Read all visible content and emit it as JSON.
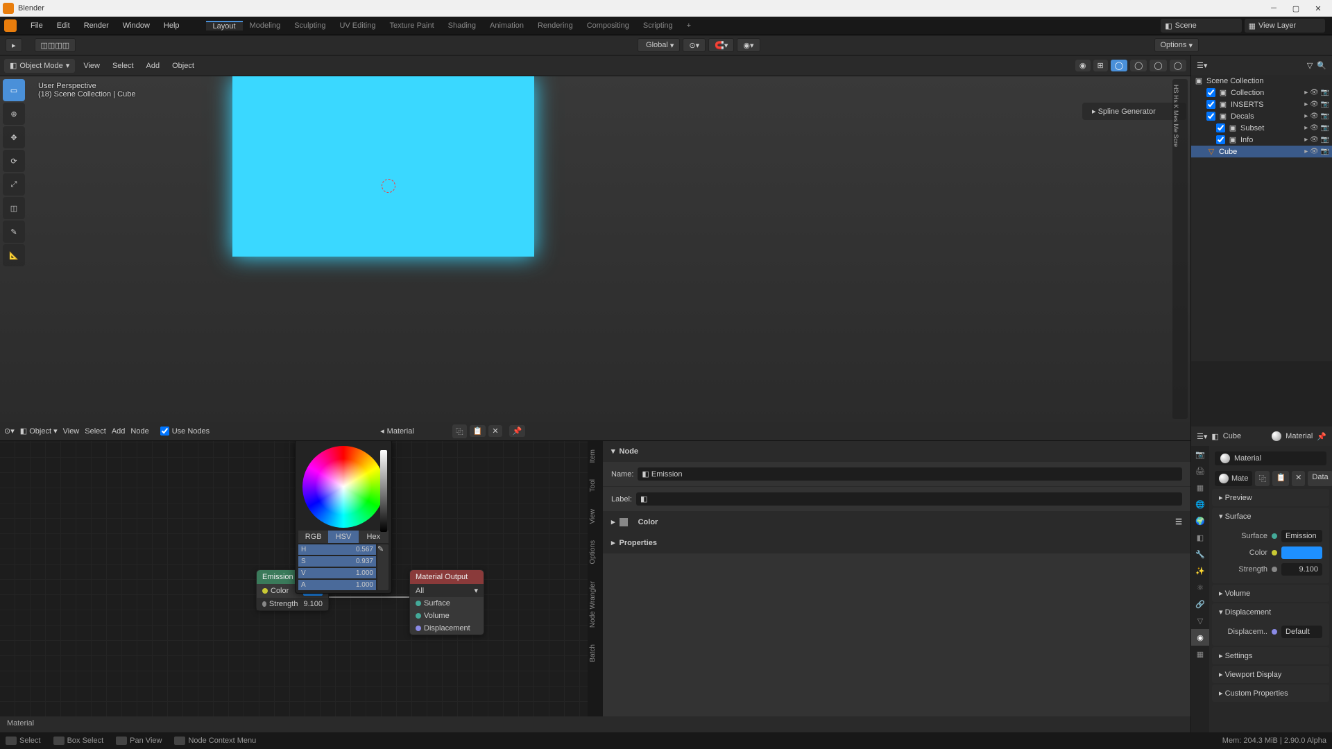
{
  "titlebar": {
    "app": "Blender"
  },
  "topmenu": {
    "file": "File",
    "edit": "Edit",
    "render": "Render",
    "window": "Window",
    "help": "Help"
  },
  "workspaces": [
    "Layout",
    "Modeling",
    "Sculpting",
    "UV Editing",
    "Texture Paint",
    "Shading",
    "Animation",
    "Rendering",
    "Compositing",
    "Scripting"
  ],
  "scene_field": {
    "label": "Scene",
    "viewlayer": "View Layer"
  },
  "toolbar": {
    "options": "Options"
  },
  "global": "Global",
  "viewport": {
    "mode": "Object Mode",
    "menus": [
      "View",
      "Select",
      "Add",
      "Object"
    ],
    "persp": "User Perspective",
    "collection": "(18) Scene Collection | Cube",
    "spline": "Spline Generator"
  },
  "node_editor": {
    "mode": "Object",
    "menus": [
      "View",
      "Select",
      "Add",
      "Node"
    ],
    "use_nodes": "Use Nodes",
    "material_name": "Material",
    "footer": "Material",
    "right_tabs": [
      "Item",
      "Tool",
      "View",
      "Options",
      "Node Wrangler",
      "Batch"
    ]
  },
  "emission_node": {
    "title": "Emission",
    "color_label": "Color",
    "strength_label": "Strength",
    "strength_val": "9.100"
  },
  "matout_node": {
    "title": "Material Output",
    "target": "All",
    "surface": "Surface",
    "volume": "Volume",
    "displacement": "Displacement"
  },
  "color_picker": {
    "tabs": {
      "rgb": "RGB",
      "hsv": "HSV",
      "hex": "Hex"
    },
    "h": {
      "label": "H",
      "val": "0.567"
    },
    "s": {
      "label": "S",
      "val": "0.937"
    },
    "v": {
      "label": "V",
      "val": "1.000"
    },
    "a": {
      "label": "A",
      "val": "1.000"
    }
  },
  "node_props": {
    "node_head": "Node",
    "name_label": "Name:",
    "name_val": "Emission",
    "label_label": "Label:",
    "color_head": "Color",
    "props_head": "Properties"
  },
  "outliner": {
    "header": "Scene Collection",
    "items": [
      {
        "name": "Collection",
        "indent": 1
      },
      {
        "name": "INSERTS",
        "indent": 1
      },
      {
        "name": "Decals",
        "indent": 1
      },
      {
        "name": "Subset",
        "indent": 2
      },
      {
        "name": "Info",
        "indent": 2
      },
      {
        "name": "Cube",
        "indent": 1,
        "selected": true
      }
    ]
  },
  "props": {
    "cube": "Cube",
    "material": "Material",
    "mate": "Mate",
    "data": "Data",
    "mat_name": "Material",
    "sections": {
      "preview": "Preview",
      "surface": "Surface",
      "surface_label": "Surface",
      "surface_val": "Emission",
      "color_label": "Color",
      "strength_label": "Strength",
      "strength_val": "9.100",
      "volume": "Volume",
      "displacement": "Displacement",
      "displace_label": "Displacem..",
      "displace_val": "Default",
      "settings": "Settings",
      "viewport_display": "Viewport Display",
      "custom_props": "Custom Properties"
    }
  },
  "statusbar": {
    "select": "Select",
    "box_select": "Box Select",
    "pan_view": "Pan View",
    "context_menu": "Node Context Menu",
    "mem": "Mem: 204.3 MiB | 2.90.0 Alpha"
  },
  "colors": {
    "emission_color": "#1e90ff"
  }
}
